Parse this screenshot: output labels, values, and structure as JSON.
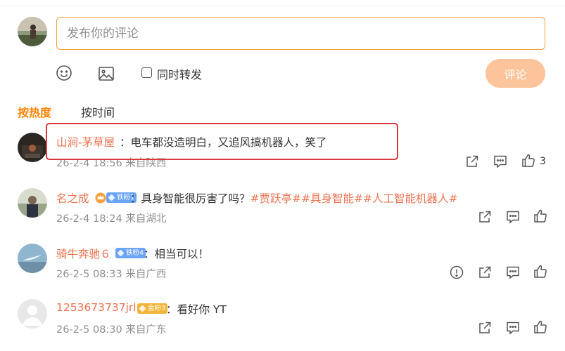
{
  "composer": {
    "placeholder": "发布你的评论",
    "repost_label": "同时转发",
    "submit_label": "评论"
  },
  "sort_tabs": {
    "hot": "按热度",
    "time": "按时间"
  },
  "comments": [
    {
      "user": "山涧-茅草屋",
      "text": "：电车都没造明白，又追风搞机器人，笑了",
      "meta": "26-2-4 18:56 来自陕西",
      "likes": "3",
      "highlighted": true
    },
    {
      "user": "名之成",
      "badge": "铁粉1",
      "text": "：具身智能很厉害了吗？",
      "topics": [
        "#贾跃亭#",
        "#具身智能#",
        "#人工智能机器人#"
      ],
      "meta": "26-2-4 18:24 来自湖北"
    },
    {
      "user": "骑牛奔驰６",
      "badge": "铁粉4",
      "text": "：相当可以！",
      "meta": "26-2-5 08:33 来自广西"
    },
    {
      "user": "1253673737jrl",
      "badge": "金粉3",
      "text": "：看好你 YT",
      "meta": "26-2-5 08:30 来自广东"
    }
  ],
  "colors": {
    "accent": "#ff8200",
    "username": "#eb7350",
    "input_border": "#f1a33e",
    "submit_bg": "#fbc49a",
    "highlight_box": "#d9383e",
    "badge_blue": "#6ca4f5",
    "badge_gold": "#f2b53a"
  },
  "icons": [
    "emoji-icon",
    "image-icon",
    "share-icon",
    "reply-icon",
    "like-icon",
    "report-icon",
    "crown-icon"
  ]
}
